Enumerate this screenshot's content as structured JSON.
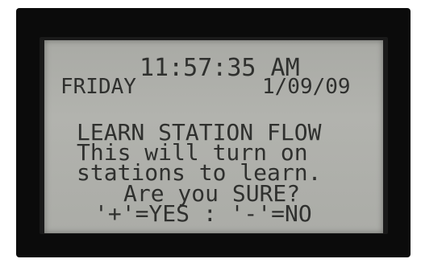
{
  "display": {
    "time": "11:57:35 AM",
    "day": "FRIDAY",
    "date": "1/09/09",
    "message_lines": [
      "LEARN STATION FLOW",
      "This will turn on",
      "stations to learn.",
      "Are you SURE?",
      "'+'=YES : '-'=NO"
    ]
  },
  "colors": {
    "lcd_background": "#b0b1ac",
    "lcd_text": "#2f302e",
    "frame": "#0b0b0b"
  }
}
